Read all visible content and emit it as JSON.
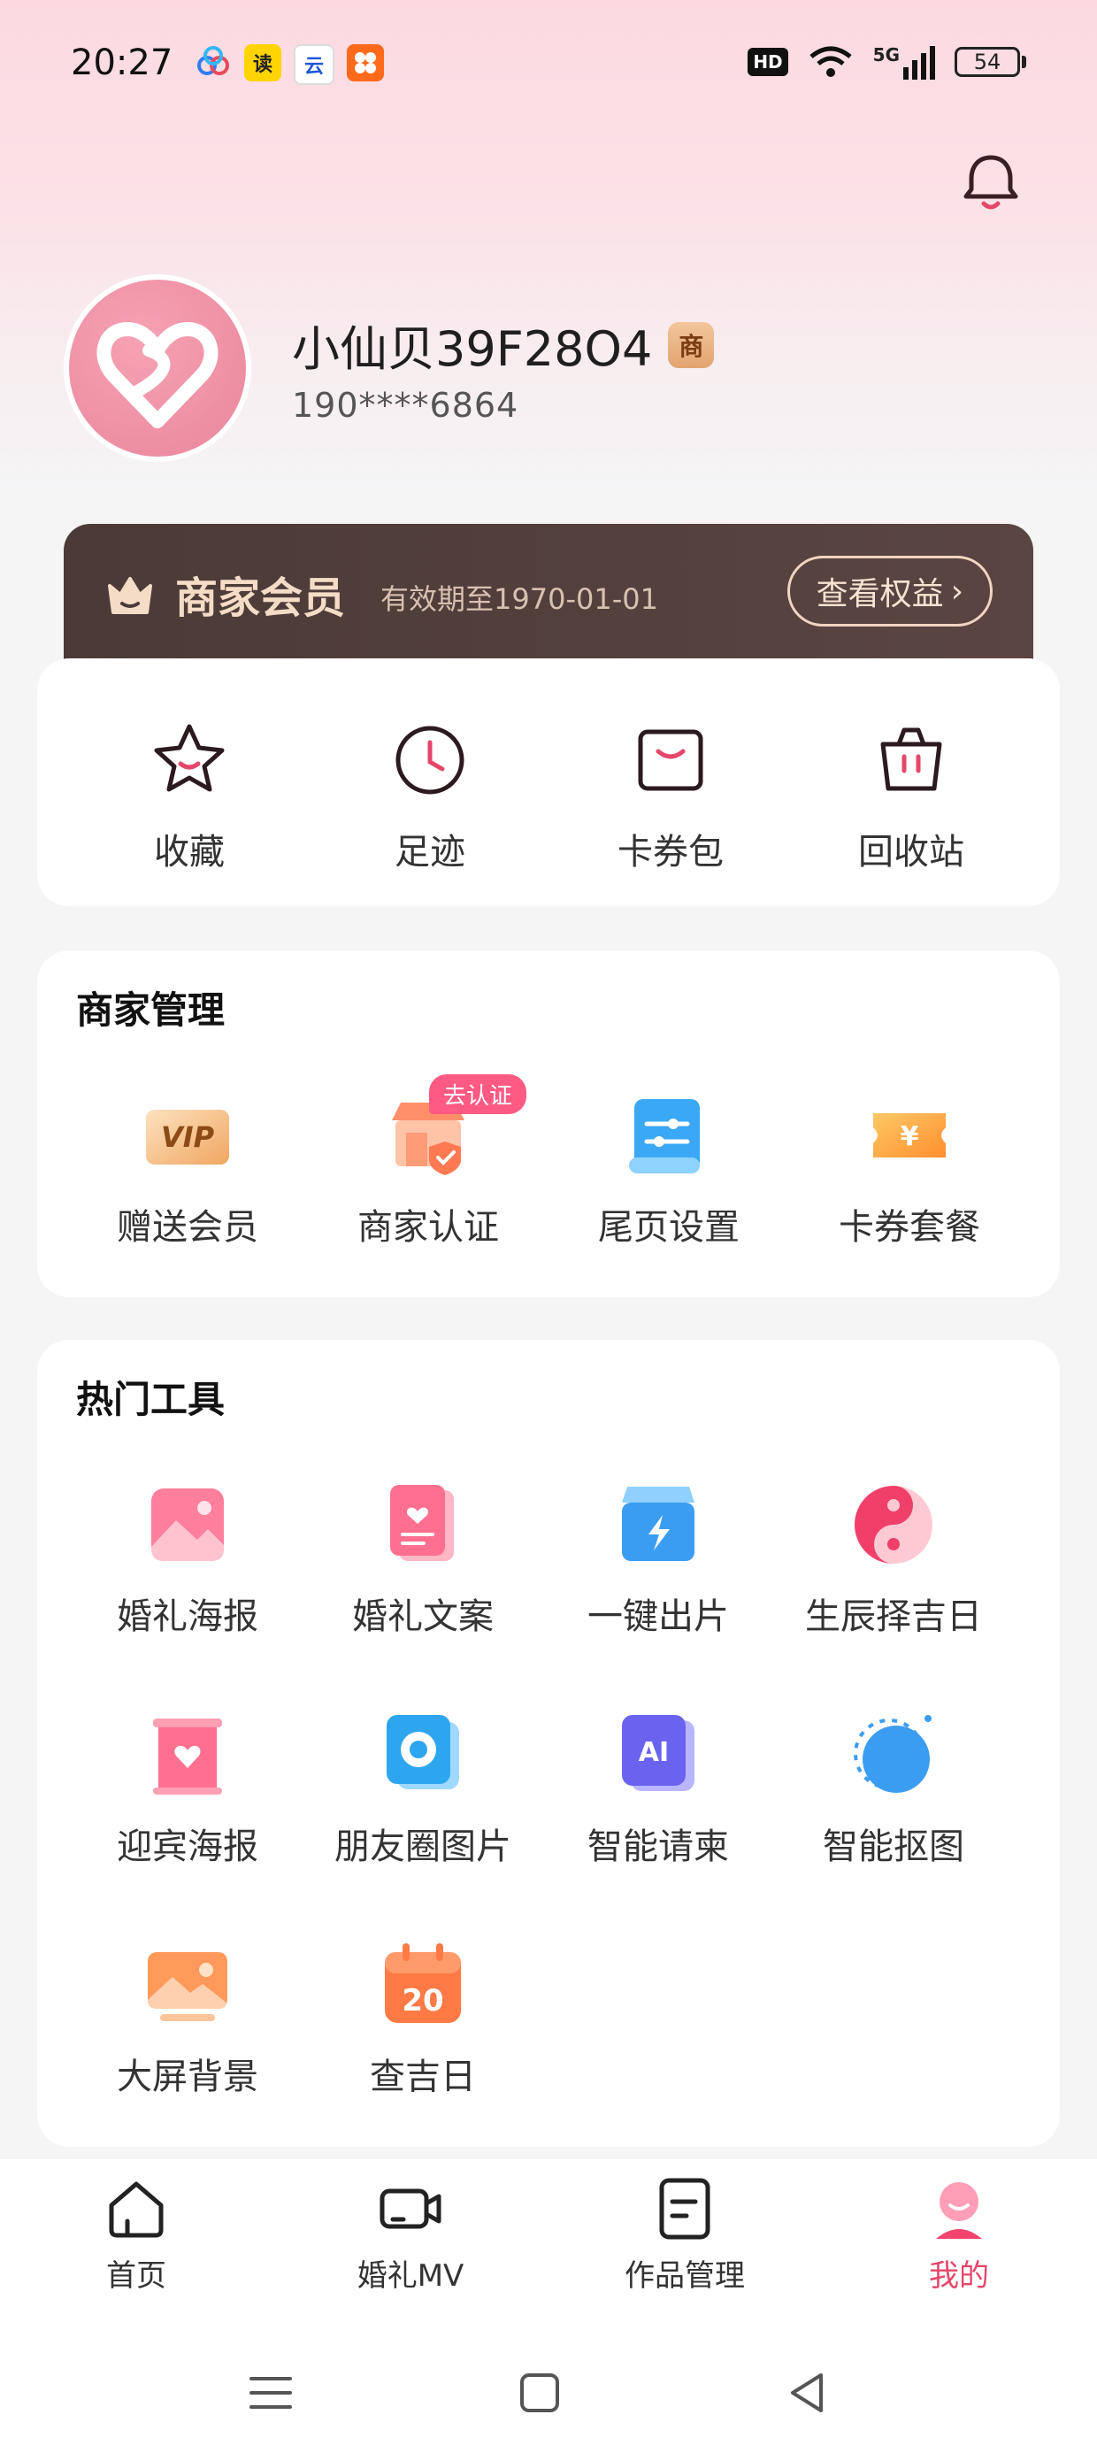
{
  "status_bar": {
    "time": "20:27",
    "notification_icons": [
      "baidu-cloud-icon",
      "reading-app-icon",
      "cloud-ai-icon",
      "shopping-app-icon"
    ],
    "hd_label": "HD",
    "network": "5G",
    "battery": "54"
  },
  "header": {
    "bell_icon": "bell-icon"
  },
  "profile": {
    "username": "小仙贝39F28O4",
    "badge": "商",
    "phone": "190****6864"
  },
  "vip": {
    "title": "商家会员",
    "expiry": "有效期至1970-01-01",
    "button": "查看权益",
    "button_arrow": "›",
    "colors": {
      "banner": "#4b3a37",
      "gold": "#f4dcc6"
    }
  },
  "quick_actions": [
    {
      "label": "收藏",
      "icon": "star-icon"
    },
    {
      "label": "足迹",
      "icon": "clock-icon"
    },
    {
      "label": "卡券包",
      "icon": "coupon-wallet-icon"
    },
    {
      "label": "回收站",
      "icon": "trash-basket-icon"
    }
  ],
  "merchant": {
    "title": "商家管理",
    "items": [
      {
        "label": "赠送会员",
        "icon": "vip-card-icon"
      },
      {
        "label": "商家认证",
        "icon": "shop-certify-icon",
        "badge": "去认证"
      },
      {
        "label": "尾页设置",
        "icon": "settings-scroll-icon"
      },
      {
        "label": "卡券套餐",
        "icon": "yen-ticket-icon"
      }
    ]
  },
  "tools": {
    "title": "热门工具",
    "items": [
      {
        "label": "婚礼海报",
        "icon": "wedding-poster-icon"
      },
      {
        "label": "婚礼文案",
        "icon": "wedding-copy-icon"
      },
      {
        "label": "一键出片",
        "icon": "one-click-video-icon"
      },
      {
        "label": "生辰择吉日",
        "icon": "yin-yang-icon"
      },
      {
        "label": "迎宾海报",
        "icon": "welcome-poster-icon"
      },
      {
        "label": "朋友圈图片",
        "icon": "camera-aperture-icon"
      },
      {
        "label": "智能请柬",
        "icon": "ai-invitation-icon"
      },
      {
        "label": "智能抠图",
        "icon": "smart-cutout-icon"
      },
      {
        "label": "大屏背景",
        "icon": "screen-background-icon"
      },
      {
        "label": "查吉日",
        "icon": "calendar-icon",
        "icon_text": "20"
      }
    ]
  },
  "tab_bar": [
    {
      "label": "首页",
      "icon": "home-icon",
      "active": false
    },
    {
      "label": "婚礼MV",
      "icon": "video-camera-icon",
      "active": false
    },
    {
      "label": "作品管理",
      "icon": "document-icon",
      "active": false
    },
    {
      "label": "我的",
      "icon": "profile-icon",
      "active": true
    }
  ],
  "accent_color": "#e5476a"
}
